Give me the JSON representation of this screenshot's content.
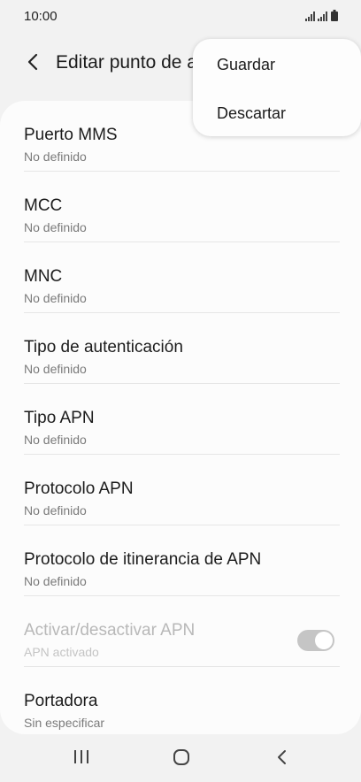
{
  "status_bar": {
    "time": "10:00",
    "signal_icon": "signal-icon",
    "battery_icon": "battery-icon"
  },
  "header": {
    "title": "Editar punto de a",
    "back_icon": "back-arrow-icon"
  },
  "menu": {
    "items": [
      {
        "label": "Guardar"
      },
      {
        "label": "Descartar"
      }
    ]
  },
  "settings": [
    {
      "label": "Puerto MMS",
      "value": "No definido"
    },
    {
      "label": "MCC",
      "value": "No definido"
    },
    {
      "label": "MNC",
      "value": "No definido"
    },
    {
      "label": "Tipo de autenticación",
      "value": "No definido"
    },
    {
      "label": "Tipo APN",
      "value": "No definido"
    },
    {
      "label": "Protocolo APN",
      "value": "No definido"
    },
    {
      "label": "Protocolo de itinerancia de APN",
      "value": "No definido"
    },
    {
      "label": "Activar/desactivar APN",
      "value": "APN activado",
      "toggle_on": true,
      "disabled": true
    },
    {
      "label": "Portadora",
      "value": "Sin especificar"
    }
  ],
  "nav_bar": {
    "recent_icon": "recent-apps-icon",
    "home_icon": "home-icon",
    "back_icon": "nav-back-icon"
  },
  "colors": {
    "background": "#f2f2f2",
    "card": "#fcfcfc",
    "primary_text": "#1c1c1c",
    "secondary_text": "#7a7a7a",
    "disabled_text": "#b8b8b8",
    "toggle": "#c5c5c5"
  }
}
